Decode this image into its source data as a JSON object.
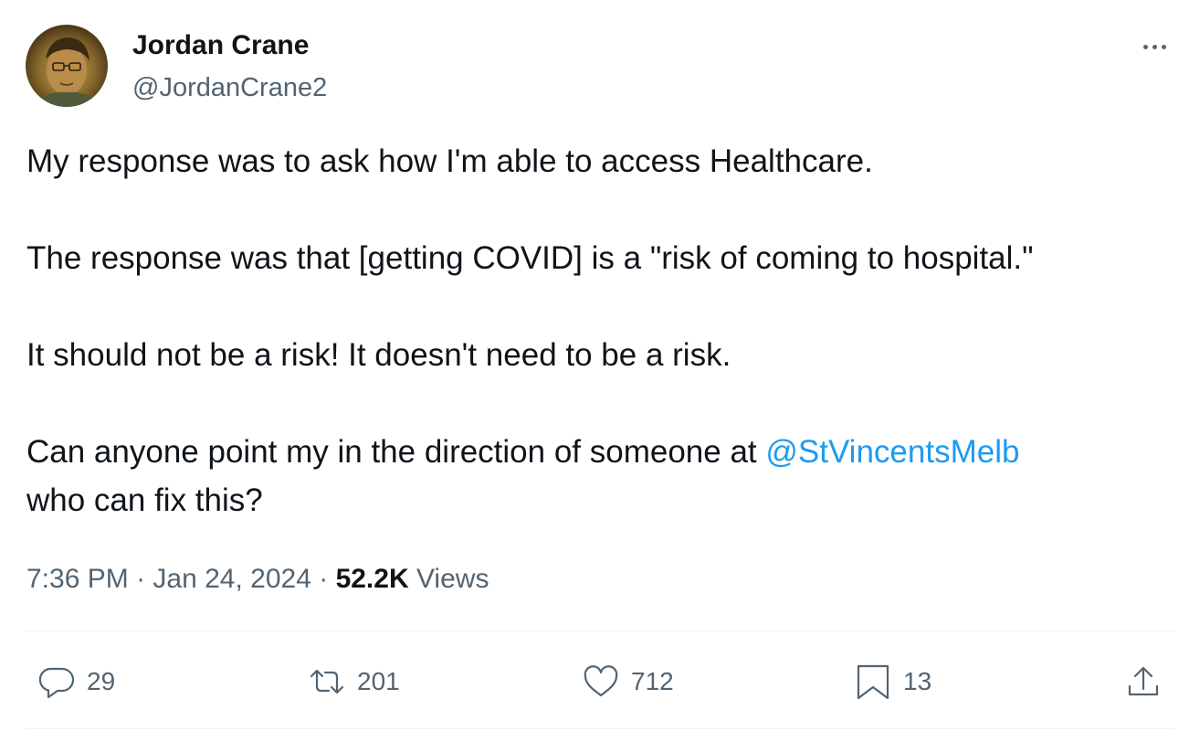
{
  "author": {
    "name": "Jordan Crane",
    "handle": "@JordanCrane2"
  },
  "tweet": {
    "paragraphs": [
      "My response was to ask how I'm able to access Healthcare.",
      "The response was that [getting COVID] is a \"risk of coming to hospital.\"",
      "It should not be a risk! It doesn't need to be a risk."
    ],
    "last_paragraph": {
      "before_mention": "Can anyone point my in the direction of someone at ",
      "mention": "@StVincentsMelb",
      "after_mention": "who can fix this?"
    }
  },
  "meta": {
    "time": "7:36 PM",
    "separator": " · ",
    "date": "Jan 24, 2024",
    "views_count": "52.2K",
    "views_label": " Views"
  },
  "actions": {
    "replies": "29",
    "retweets": "201",
    "likes": "712",
    "bookmarks": "13"
  },
  "icons": {
    "more": "more-horizontal-icon",
    "reply": "reply-icon",
    "retweet": "retweet-icon",
    "like": "heart-icon",
    "bookmark": "bookmark-icon",
    "share": "share-icon"
  },
  "colors": {
    "text": "#0f1419",
    "secondary": "#536471",
    "link": "#1d9bf0",
    "divider": "#eff3f4"
  }
}
